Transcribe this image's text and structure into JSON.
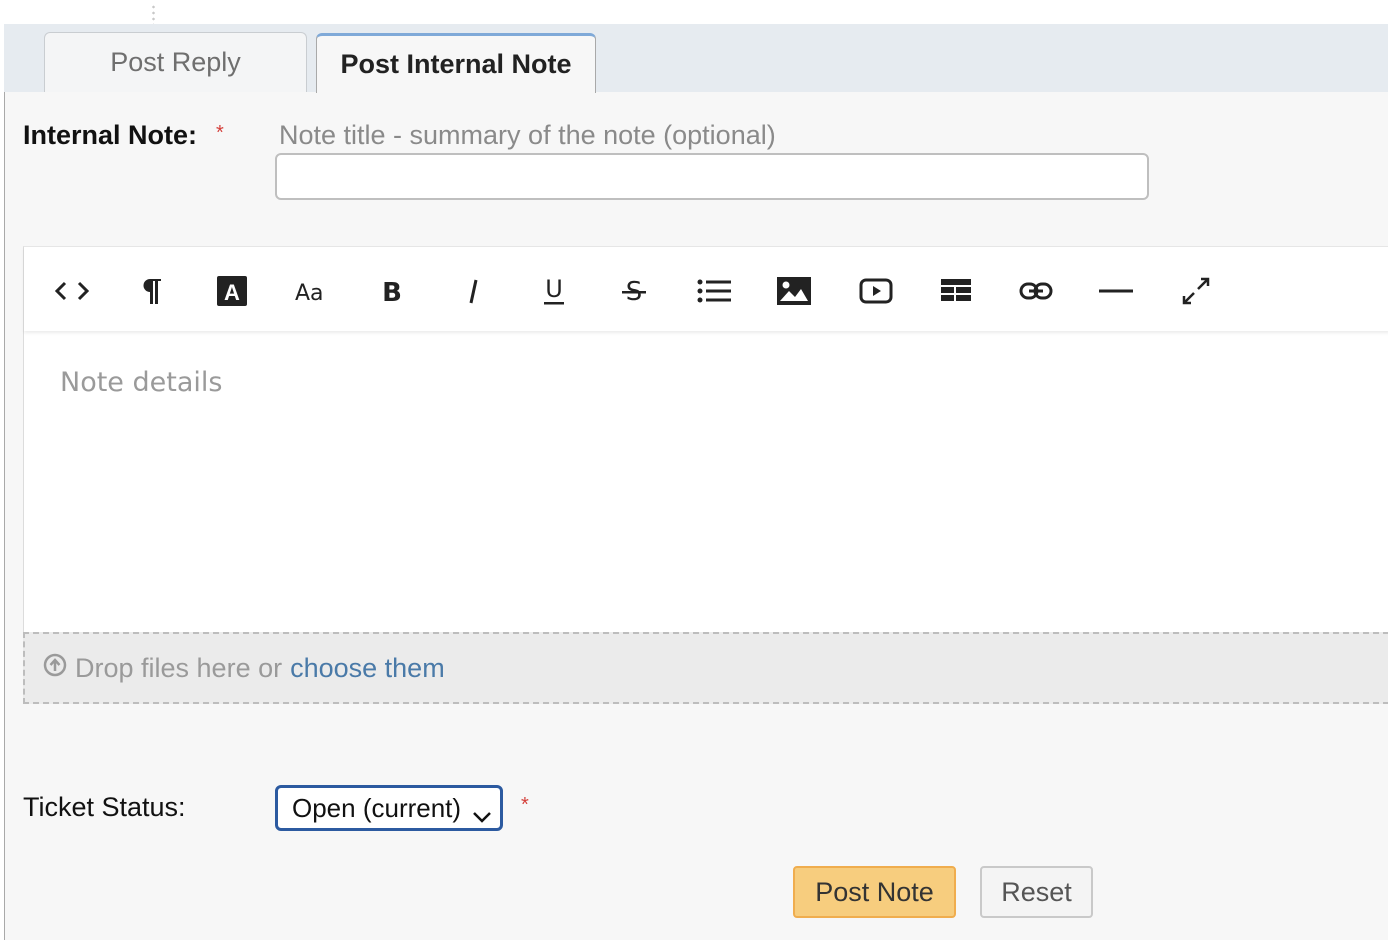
{
  "tabs": [
    {
      "label": "Post Reply",
      "active": false
    },
    {
      "label": "Post Internal Note",
      "active": true
    }
  ],
  "note": {
    "label": "Internal Note:",
    "required_mark": "*",
    "title_hint": "Note title - summary of the note (optional)",
    "title_value": ""
  },
  "editor": {
    "toolbar": [
      {
        "name": "code-view-icon"
      },
      {
        "name": "paragraph-icon"
      },
      {
        "name": "font-color-icon",
        "glyph": "A"
      },
      {
        "name": "font-size-icon",
        "glyph": "Aa"
      },
      {
        "name": "bold-icon",
        "glyph": "B"
      },
      {
        "name": "italic-icon",
        "glyph": "I"
      },
      {
        "name": "underline-icon",
        "glyph": "U"
      },
      {
        "name": "strikethrough-icon",
        "glyph": "S"
      },
      {
        "name": "unordered-list-icon"
      },
      {
        "name": "image-icon"
      },
      {
        "name": "video-icon"
      },
      {
        "name": "table-icon"
      },
      {
        "name": "link-icon"
      },
      {
        "name": "horizontal-rule-icon"
      },
      {
        "name": "fullscreen-icon"
      }
    ],
    "placeholder": "Note details"
  },
  "dropzone": {
    "text": "Drop files here or",
    "link": "choose them"
  },
  "status": {
    "label": "Ticket Status:",
    "selected": "Open (current)",
    "required_mark": "*"
  },
  "actions": {
    "post": "Post Note",
    "reset": "Reset"
  },
  "colors": {
    "accent": "#2c5aa0",
    "post_button": "#f7cd7e",
    "required": "#d43f3a",
    "link": "#4a7aa8"
  }
}
